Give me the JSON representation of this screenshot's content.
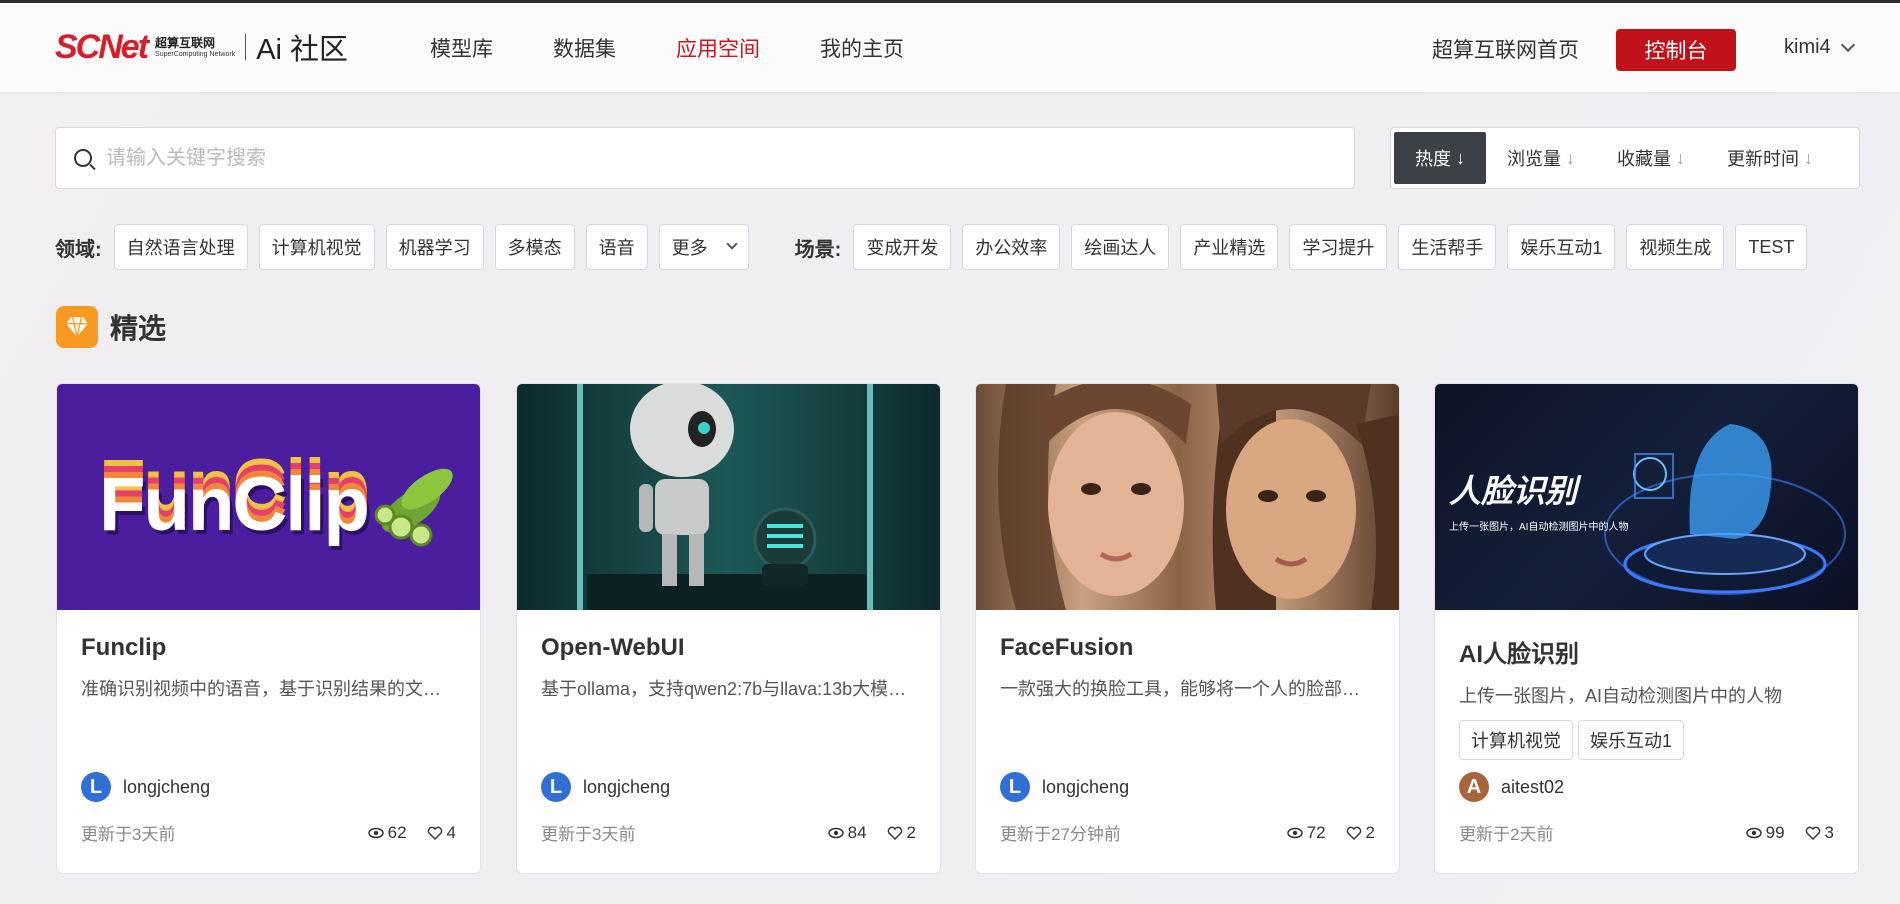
{
  "header": {
    "logo_main": "SCNet",
    "logo_cn": "超算互联网",
    "logo_en": "SuperComputing Network",
    "logo_ai": "Ai 社区",
    "nav": [
      {
        "label": "模型库",
        "active": false
      },
      {
        "label": "数据集",
        "active": false
      },
      {
        "label": "应用空间",
        "active": true
      },
      {
        "label": "我的主页",
        "active": false
      }
    ],
    "home_link": "超算互联网首页",
    "console": "控制台",
    "user": "kimi4"
  },
  "search": {
    "placeholder": "请输入关键字搜索"
  },
  "sort": [
    {
      "label": "热度",
      "arrow": "↓",
      "active": true
    },
    {
      "label": "浏览量",
      "arrow": "↓",
      "active": false
    },
    {
      "label": "收藏量",
      "arrow": "↓",
      "active": false
    },
    {
      "label": "更新时间",
      "arrow": "↓",
      "active": false
    }
  ],
  "filters": {
    "domain_label": "领域:",
    "domains": [
      "自然语言处理",
      "计算机视觉",
      "机器学习",
      "多模态",
      "语音"
    ],
    "more": "更多",
    "scene_label": "场景:",
    "scenes": [
      "变成开发",
      "办公效率",
      "绘画达人",
      "产业精选",
      "学习提升",
      "生活帮手",
      "娱乐互动1",
      "视频生成",
      "TEST"
    ]
  },
  "section": {
    "title": "精选"
  },
  "cards": [
    {
      "title": "Funclip",
      "desc": "准确识别视频中的语音，基于识别结果的文…",
      "tags": [],
      "author": "longjcheng",
      "avatar": "L",
      "avatar_color": "#2f6fd6",
      "updated": "更新于3天前",
      "views": "62",
      "likes": "4",
      "image_text": "FunClip"
    },
    {
      "title": "Open-WebUI",
      "desc": "基于ollama，支持qwen2:7b与llava:13b大模…",
      "tags": [],
      "author": "longjcheng",
      "avatar": "L",
      "avatar_color": "#2f6fd6",
      "updated": "更新于3天前",
      "views": "84",
      "likes": "2"
    },
    {
      "title": "FaceFusion",
      "desc": "一款强大的换脸工具，能够将一个人的脸部…",
      "tags": [],
      "author": "longjcheng",
      "avatar": "L",
      "avatar_color": "#2f6fd6",
      "updated": "更新于27分钟前",
      "views": "72",
      "likes": "2"
    },
    {
      "title": "AI人脸识别",
      "desc": "上传一张图片，AI自动检测图片中的人物",
      "tags": [
        "计算机视觉",
        "娱乐互动1"
      ],
      "author": "aitest02",
      "avatar": "A",
      "avatar_color": "#a8643a",
      "updated": "更新于2天前",
      "views": "99",
      "likes": "3",
      "image_title": "人脸识别",
      "image_sub": "上传一张图片，AI自动检测图片中的人物"
    }
  ]
}
